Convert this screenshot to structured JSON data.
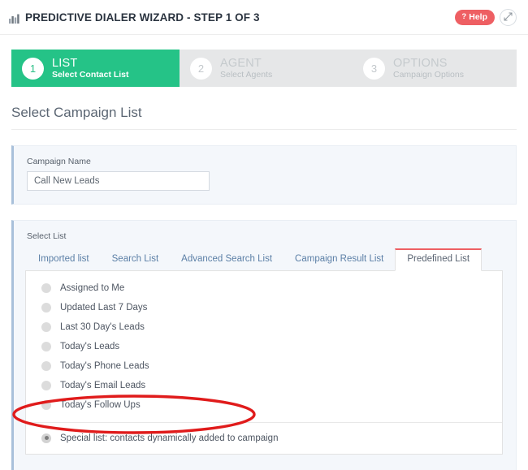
{
  "header": {
    "icon": "chart-bar-icon",
    "title": "PREDICTIVE DIALER WIZARD - STEP 1 OF 3",
    "help_label": "Help",
    "help_marker": "?",
    "help_color": "#ee5f63",
    "expand_icon": "expand-arrows-icon"
  },
  "steps": [
    {
      "number": "1",
      "title": "LIST",
      "subtitle": "Select Contact List",
      "state": "active",
      "color": "#25c387"
    },
    {
      "number": "2",
      "title": "AGENT",
      "subtitle": "Select Agents",
      "state": "inactive",
      "color": "#e6e7e8"
    },
    {
      "number": "3",
      "title": "OPTIONS",
      "subtitle": "Campaign Options",
      "state": "inactive",
      "color": "#e6e7e8"
    }
  ],
  "section": {
    "title": "Select Campaign List"
  },
  "campaign": {
    "label": "Campaign Name",
    "value": "Call New Leads",
    "placeholder": "Campaign Name"
  },
  "select_list": {
    "label": "Select List",
    "tabs": [
      {
        "label": "Imported list",
        "active": false
      },
      {
        "label": "Search List",
        "active": false
      },
      {
        "label": "Advanced Search List",
        "active": false
      },
      {
        "label": "Campaign Result List",
        "active": false
      },
      {
        "label": "Predefined List",
        "active": true
      }
    ],
    "active_tab_accent": "#ee5f63",
    "options": [
      {
        "label": "Assigned to Me",
        "checked": false
      },
      {
        "label": "Updated Last 7 Days",
        "checked": false
      },
      {
        "label": "Last 30 Day's Leads",
        "checked": false
      },
      {
        "label": "Today's Leads",
        "checked": false
      },
      {
        "label": "Today's Phone Leads",
        "checked": false
      },
      {
        "label": "Today's Email Leads",
        "checked": false
      },
      {
        "label": "Today's Follow Ups",
        "checked": false
      }
    ],
    "special_option": {
      "label": "Special list: contacts dynamically added to campaign",
      "checked": true
    }
  },
  "annotation": {
    "shape": "ellipse",
    "color": "#e01b1b",
    "target": "special-list-option"
  }
}
